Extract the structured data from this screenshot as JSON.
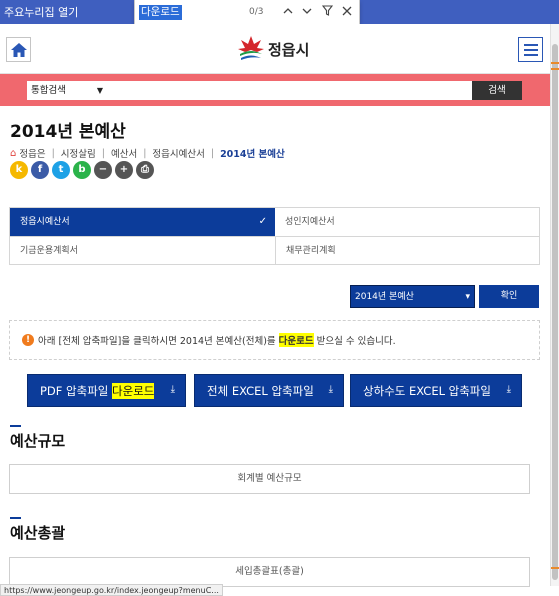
{
  "browser": {
    "strip_label": "주요누리집 열기",
    "find": {
      "query": "다운로드",
      "count": "0/3"
    },
    "status_url": "https://www.jeongeup.go.kr/index.jeongeup?menuC..."
  },
  "header": {
    "logo_text": "정읍시"
  },
  "search": {
    "scope": "통합검색",
    "button": "검색"
  },
  "page": {
    "title": "2014년 본예산",
    "breadcrumb": [
      "정읍은",
      "시정살림",
      "예산서",
      "정읍시예산서",
      "2014년 본예산"
    ]
  },
  "share": [
    {
      "icon": "kakaostory-icon",
      "glyph": "k",
      "color": "#f5b800"
    },
    {
      "icon": "facebook-icon",
      "glyph": "f",
      "color": "#3b5ba7"
    },
    {
      "icon": "twitter-icon",
      "glyph": "t",
      "color": "#1da1e6"
    },
    {
      "icon": "band-icon",
      "glyph": "b",
      "color": "#2bb34a"
    },
    {
      "icon": "zoom-out-icon",
      "glyph": "−",
      "color": "#555555"
    },
    {
      "icon": "zoom-in-icon",
      "glyph": "+",
      "color": "#555555"
    },
    {
      "icon": "print-icon",
      "glyph": "⎙",
      "color": "#555555"
    }
  ],
  "tabs": [
    {
      "label": "정읍시예산서",
      "active": true
    },
    {
      "label": "성인지예산서",
      "active": false
    },
    {
      "label": "기금운용계획서",
      "active": false
    },
    {
      "label": "채무관리계획",
      "active": false
    }
  ],
  "year_select": {
    "value": "2014년 본예산",
    "confirm": "확인"
  },
  "notice": {
    "before": "아래 [전체 압축파일]을 클릭하시면 2014년 본예산(전체)를 ",
    "highlight": "다운로드",
    "after": " 받으실 수 있습니다."
  },
  "downloads": [
    {
      "label": "PDF 압축파일 ",
      "highlight": "다운로드"
    },
    {
      "label": "전체 EXCEL 압축파일",
      "highlight": ""
    },
    {
      "label": "상하수도 EXCEL 압축파일",
      "highlight": ""
    }
  ],
  "sections": [
    {
      "title": "예산규모",
      "item": "회계별 예산규모"
    },
    {
      "title": "예산총괄",
      "item": "세입총괄표(총괄)"
    }
  ],
  "colors": {
    "primary": "#0c3c9a",
    "search_band": "#f0686e",
    "highlight": "#ffff00"
  }
}
